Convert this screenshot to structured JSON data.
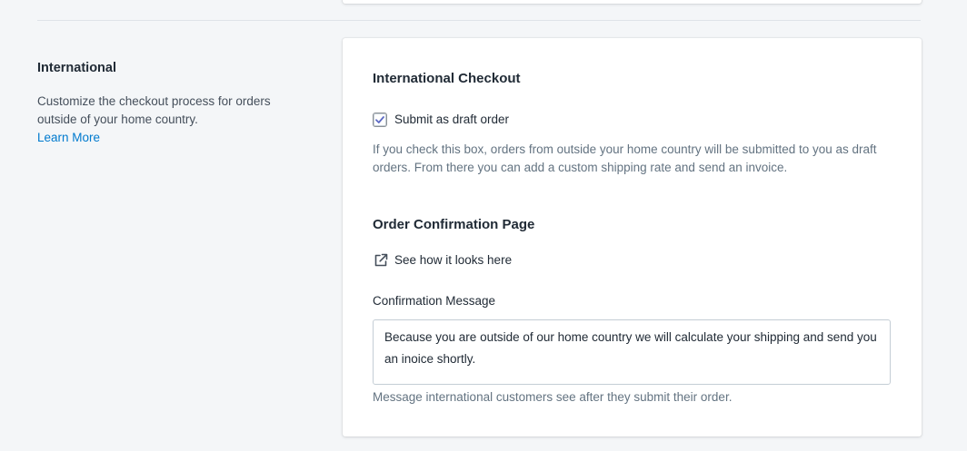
{
  "section": {
    "title": "International",
    "description": "Customize the checkout process for orders outside of your home country.",
    "learn_more": "Learn More"
  },
  "checkout": {
    "heading": "International Checkout",
    "checkbox_label": "Submit as draft order",
    "checkbox_checked": true,
    "help_text": "If you check this box, orders from outside your home country will be submitted to you as draft orders. From there you can add a custom shipping rate and send an invoice."
  },
  "confirmation": {
    "heading": "Order Confirmation Page",
    "preview_link": "See how it looks here",
    "preview_icon": "external-link-icon",
    "field_label": "Confirmation Message",
    "message_value": "Because you are outside of our home country we will calculate your shipping and send you an inoice shortly.",
    "help_text": "Message international customers see after they submit their order."
  },
  "colors": {
    "link": "#007ace",
    "checkbox_tick": "#5c6ac4",
    "muted_text": "#637381"
  }
}
